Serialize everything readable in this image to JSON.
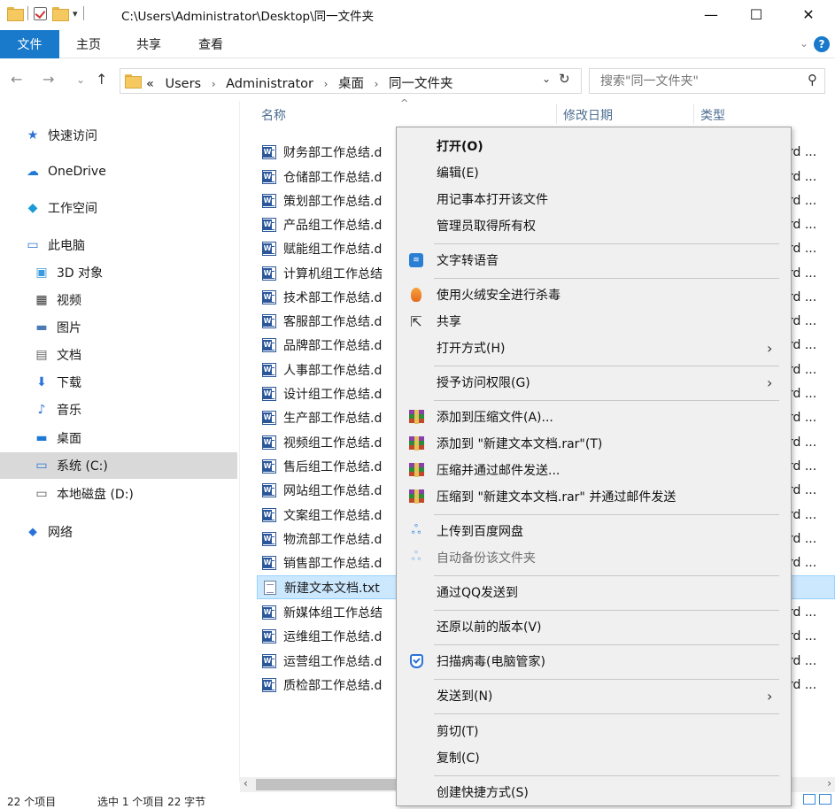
{
  "titlebar": {
    "path": "C:\\Users\\Administrator\\Desktop\\同一文件夹",
    "qa_caret": "▾",
    "minimize": "—",
    "maximize": "☐",
    "close": "✕"
  },
  "ribbon": {
    "tabs": [
      {
        "label": "文件"
      },
      {
        "label": "主页"
      },
      {
        "label": "共享"
      },
      {
        "label": "查看"
      }
    ],
    "expand": "⌄",
    "help": "?"
  },
  "nav": {
    "back": "←",
    "forward": "→",
    "recent": "⌄",
    "up": "↑"
  },
  "address": {
    "overflow": "«",
    "crumbs": [
      "Users",
      "Administrator",
      "桌面",
      "同一文件夹"
    ],
    "separator": "›",
    "dropdown": "⌄",
    "refresh": "↻"
  },
  "search": {
    "placeholder": "搜索\"同一文件夹\"",
    "icon": "⚲"
  },
  "sidebar": {
    "items": [
      {
        "label": "快速访问",
        "icon": "★"
      },
      {
        "label": "OneDrive",
        "icon": "☁"
      },
      {
        "label": "工作空间",
        "icon": "◆"
      },
      {
        "label": "此电脑",
        "icon": "▭"
      },
      {
        "label": "3D 对象",
        "icon": "▣"
      },
      {
        "label": "视频",
        "icon": "▦"
      },
      {
        "label": "图片",
        "icon": "▬"
      },
      {
        "label": "文档",
        "icon": "▤"
      },
      {
        "label": "下载",
        "icon": "⬇"
      },
      {
        "label": "音乐",
        "icon": "♪"
      },
      {
        "label": "桌面",
        "icon": "▬"
      },
      {
        "label": "系统 (C:)",
        "icon": "▭"
      },
      {
        "label": "本地磁盘 (D:)",
        "icon": "▭"
      },
      {
        "label": "网络",
        "icon": "⬥"
      }
    ]
  },
  "columns": {
    "name": "名称",
    "modified": "修改日期",
    "type": "类型",
    "sort_caret": "^"
  },
  "files": [
    {
      "name": "财务部工作总结.d",
      "type": "rd ..."
    },
    {
      "name": "仓储部工作总结.d",
      "type": "rd ..."
    },
    {
      "name": "策划部工作总结.d",
      "type": "rd ..."
    },
    {
      "name": "产品组工作总结.d",
      "type": "rd ..."
    },
    {
      "name": "赋能组工作总结.d",
      "type": "rd ..."
    },
    {
      "name": "计算机组工作总结",
      "type": "rd ..."
    },
    {
      "name": "技术部工作总结.d",
      "type": "rd ..."
    },
    {
      "name": "客服部工作总结.d",
      "type": "rd ..."
    },
    {
      "name": "品牌部工作总结.d",
      "type": "rd ..."
    },
    {
      "name": "人事部工作总结.d",
      "type": "rd ..."
    },
    {
      "name": "设计组工作总结.d",
      "type": "rd ..."
    },
    {
      "name": "生产部工作总结.d",
      "type": "rd ..."
    },
    {
      "name": "视频组工作总结.d",
      "type": "rd ..."
    },
    {
      "name": "售后组工作总结.d",
      "type": "rd ..."
    },
    {
      "name": "网站组工作总结.d",
      "type": "rd ..."
    },
    {
      "name": "文案组工作总结.d",
      "type": "rd ..."
    },
    {
      "name": "物流部工作总结.d",
      "type": "rd ..."
    },
    {
      "name": "销售部工作总结.d",
      "type": "rd ..."
    },
    {
      "name": "新建文本文档.txt",
      "type": ""
    },
    {
      "name": "新媒体组工作总结",
      "type": "rd ..."
    },
    {
      "name": "运维组工作总结.d",
      "type": "rd ..."
    },
    {
      "name": "运营组工作总结.d",
      "type": "rd ..."
    },
    {
      "name": "质检部工作总结.d",
      "type": "rd ..."
    }
  ],
  "scrollbar": {
    "left": "‹",
    "right": "›"
  },
  "status": {
    "items": "22 个项目",
    "selected": "选中 1 个项目 22 字节"
  },
  "context_menu": {
    "open": "打开(O)",
    "edit": "编辑(E)",
    "notepad": "用记事本打开该文件",
    "ownership": "管理员取得所有权",
    "tts": "文字转语音",
    "huorong": "使用火绒安全进行杀毒",
    "share": "共享",
    "open_with": "打开方式(H)",
    "grant_access": "授予访问权限(G)",
    "add_archive": "添加到压缩文件(A)...",
    "add_rar": "添加到 \"新建文本文档.rar\"(T)",
    "compress_email": "压缩并通过邮件发送...",
    "compress_rar_email": "压缩到 \"新建文本文档.rar\" 并通过邮件发送",
    "baidu_upload": "上传到百度网盘",
    "baidu_backup": "自动备份该文件夹",
    "qq_send": "通过QQ发送到",
    "restore": "还原以前的版本(V)",
    "scan_virus": "扫描病毒(电脑管家)",
    "send_to": "发送到(N)",
    "cut": "剪切(T)",
    "copy": "复制(C)",
    "shortcut": "创建快捷方式(S)",
    "submenu_arrow": "›"
  }
}
